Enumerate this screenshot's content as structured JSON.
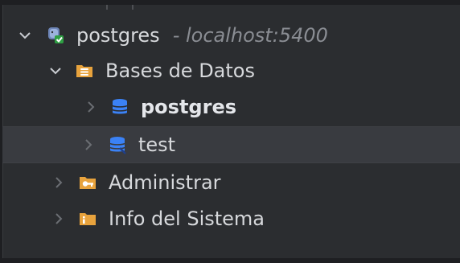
{
  "tree": {
    "connection": {
      "label": "postgres",
      "host": "- localhost:5400",
      "icon": "postgres-connection-icon",
      "expanded": true
    },
    "databases_folder": {
      "label": "Bases de Datos",
      "icon": "folder-icon",
      "expanded": true
    },
    "databases": [
      {
        "label": "postgres",
        "icon": "database-icon",
        "bold": true,
        "expanded": false
      },
      {
        "label": "test",
        "icon": "database-icon",
        "bold": false,
        "expanded": false,
        "selected": true
      }
    ],
    "admin_folder": {
      "label": "Administrar",
      "icon": "admin-folder-icon",
      "expanded": false
    },
    "sysinfo_folder": {
      "label": "Info del Sistema",
      "icon": "info-folder-icon",
      "expanded": false
    }
  },
  "colors": {
    "background": "#2b2d30",
    "selection": "#393b40",
    "text": "#d7d9dc",
    "muted": "#8a8d93",
    "folder_orange": "#e8a33d",
    "database_blue": "#3b82f6"
  }
}
